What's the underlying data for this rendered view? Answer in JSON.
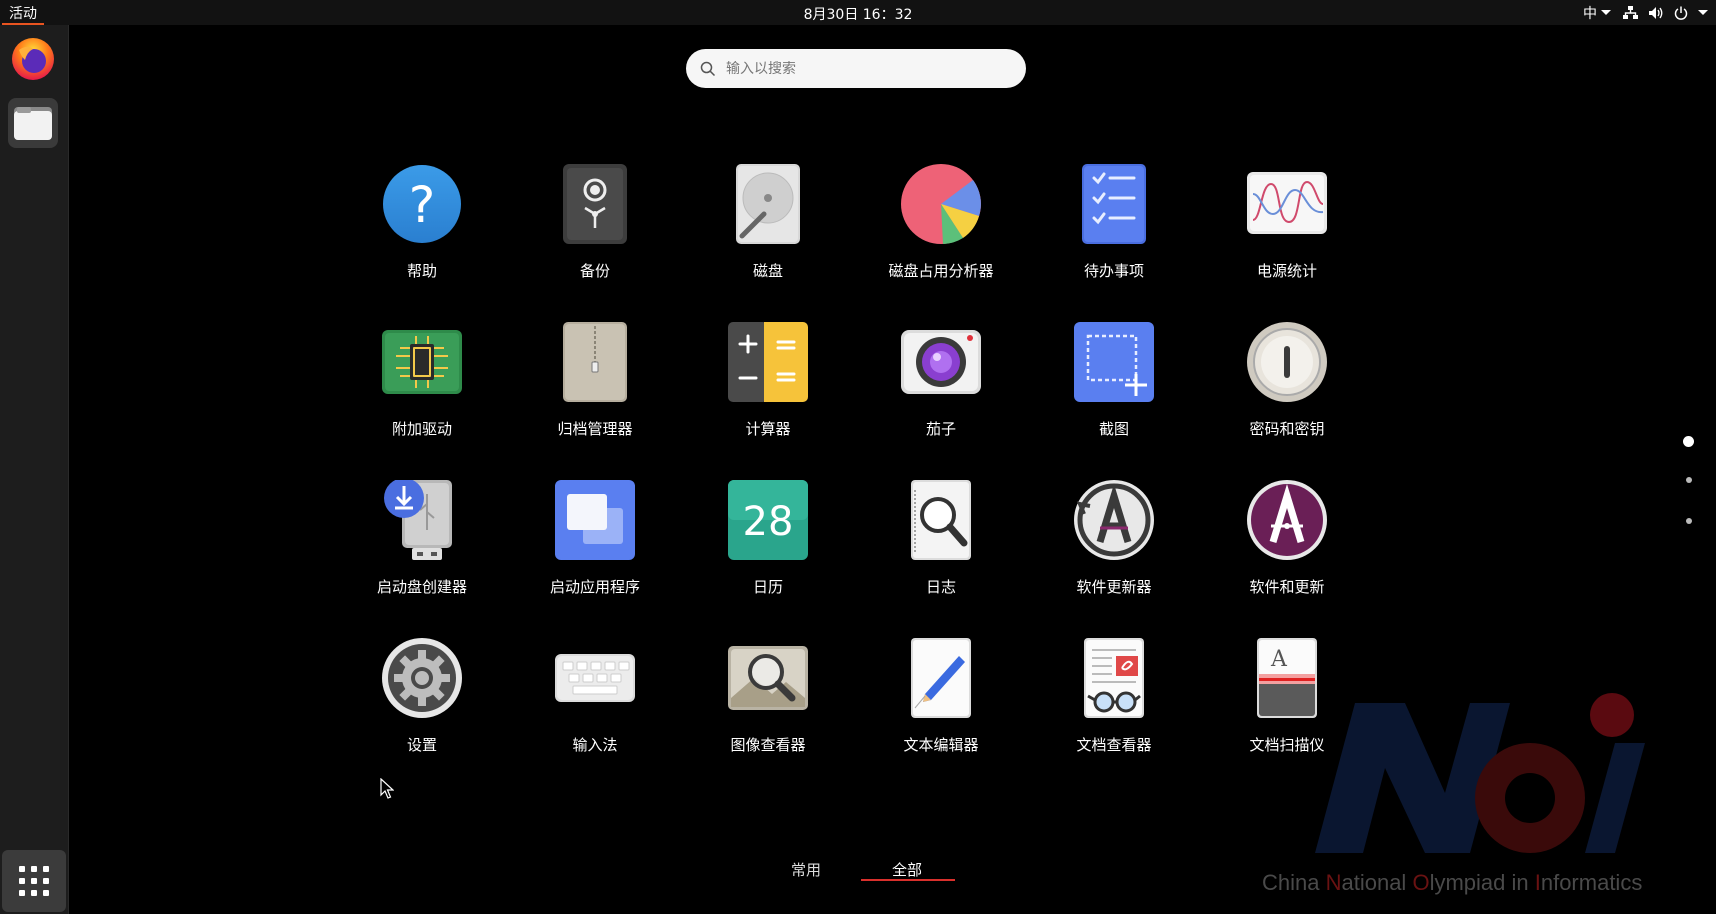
{
  "topbar": {
    "activities": "活动",
    "clock": "8月30日  16：32",
    "input_method": "中"
  },
  "search": {
    "placeholder": "输入以搜索"
  },
  "apps": [
    {
      "label": "帮助",
      "icon": "help-icon"
    },
    {
      "label": "备份",
      "icon": "backup-icon"
    },
    {
      "label": "磁盘",
      "icon": "disks-icon"
    },
    {
      "label": "磁盘占用分析器",
      "icon": "disk-usage-analyzer-icon"
    },
    {
      "label": "待办事项",
      "icon": "todo-icon"
    },
    {
      "label": "电源统计",
      "icon": "power-statistics-icon"
    },
    {
      "label": "附加驱动",
      "icon": "additional-drivers-icon"
    },
    {
      "label": "归档管理器",
      "icon": "archive-manager-icon"
    },
    {
      "label": "计算器",
      "icon": "calculator-icon"
    },
    {
      "label": "茄子",
      "icon": "cheese-icon"
    },
    {
      "label": "截图",
      "icon": "screenshot-icon"
    },
    {
      "label": "密码和密钥",
      "icon": "passwords-keys-icon"
    },
    {
      "label": "启动盘创建器",
      "icon": "startup-disk-creator-icon"
    },
    {
      "label": "启动应用程序",
      "icon": "startup-applications-icon"
    },
    {
      "label": "日历",
      "icon": "calendar-icon",
      "icon_text": "28"
    },
    {
      "label": "日志",
      "icon": "logs-icon"
    },
    {
      "label": "软件更新器",
      "icon": "software-updater-icon"
    },
    {
      "label": "软件和更新",
      "icon": "software-properties-icon"
    },
    {
      "label": "设置",
      "icon": "settings-icon"
    },
    {
      "label": "输入法",
      "icon": "input-method-icon"
    },
    {
      "label": "图像查看器",
      "icon": "image-viewer-icon"
    },
    {
      "label": "文本编辑器",
      "icon": "text-editor-icon"
    },
    {
      "label": "文档查看器",
      "icon": "document-viewer-icon"
    },
    {
      "label": "文档扫描仪",
      "icon": "document-scanner-icon",
      "icon_text": "A"
    }
  ],
  "tabs": {
    "frequent": "常用",
    "all": "全部",
    "active": "all"
  },
  "pages": {
    "count": 3,
    "current": 1
  },
  "watermark": {
    "logo": "NOI",
    "text_parts": [
      "China ",
      "N",
      "ational ",
      "O",
      "lympiad in ",
      "I",
      "nformatics"
    ]
  },
  "colors": {
    "accent": "#e95420",
    "tab_underline": "#d9302c"
  }
}
